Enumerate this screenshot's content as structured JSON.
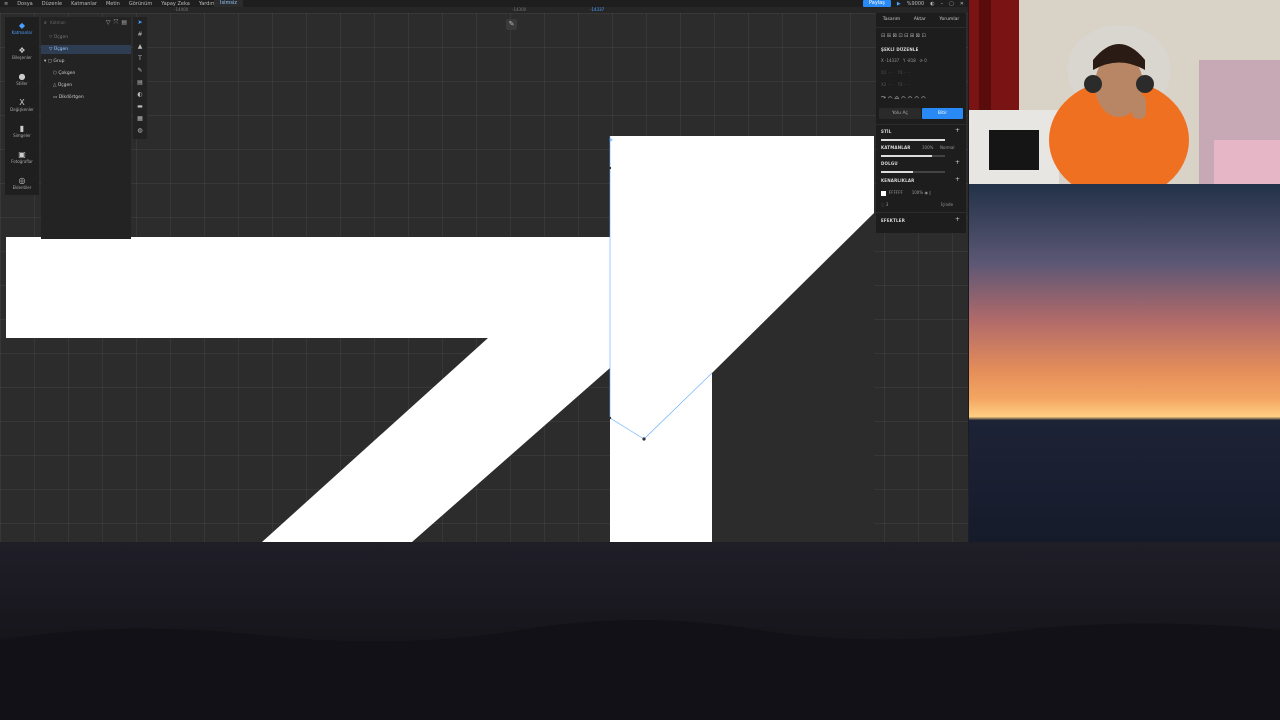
{
  "menubar": {
    "items": [
      "Dosya",
      "Düzenle",
      "Katmanlar",
      "Metin",
      "Görünüm",
      "Yapay Zeka",
      "Yardım"
    ],
    "active_tab": "İsimsiz",
    "share_label": "Paylaş",
    "zoom": "%9000"
  },
  "ruler": {
    "left_value": "-14400",
    "center_value": "-14300",
    "mark_value": "-14337"
  },
  "rail": {
    "items": [
      {
        "label": "Katmanlar",
        "icon": "layers-icon",
        "glyph": "◆",
        "active": true
      },
      {
        "label": "Bileşenler",
        "icon": "components-icon",
        "glyph": "❖",
        "active": false
      },
      {
        "label": "Stiller",
        "icon": "styles-icon",
        "glyph": "●",
        "active": false
      },
      {
        "label": "Değişkenler",
        "icon": "variables-icon",
        "glyph": "X",
        "active": false
      },
      {
        "label": "Simgeler",
        "icon": "icons-icon",
        "glyph": "▮",
        "active": false
      },
      {
        "label": "Fotoğraflar",
        "icon": "photos-icon",
        "glyph": "▣",
        "active": false
      },
      {
        "label": "Eklentiler",
        "icon": "plugins-icon",
        "glyph": "◎",
        "active": false
      }
    ]
  },
  "layers": {
    "search_placeholder": "Katman",
    "rows": [
      {
        "label": "Üçgen",
        "indent": 1,
        "state": "dim",
        "icon": "▽"
      },
      {
        "label": "Üçgen",
        "indent": 1,
        "state": "sel",
        "icon": "▽"
      },
      {
        "label": "Grup",
        "indent": 0,
        "state": "normal",
        "icon": "▢"
      },
      {
        "label": "Çokgen",
        "indent": 2,
        "state": "normal",
        "icon": "⬡"
      },
      {
        "label": "Üçgen",
        "indent": 2,
        "state": "normal",
        "icon": "△"
      },
      {
        "label": "Dikdörtgen",
        "indent": 2,
        "state": "normal",
        "icon": "▭"
      }
    ]
  },
  "tools": [
    "➤",
    "#",
    "▲",
    "T",
    "✎",
    "▤",
    "◐",
    "▬",
    "▦",
    "◍"
  ],
  "props": {
    "tabs": [
      "Tasarım",
      "Aktar",
      "Yorumlar"
    ],
    "shape_title": "ŞEKLİ DÜZENLE",
    "x_value": "-14337",
    "y_value": "-818",
    "rotation": "0",
    "btn_ghost": "Yolu Aç",
    "btn_primary": "Bitir",
    "sections": {
      "stil": "STİL",
      "katmanlar": "KATMANLAR",
      "opacity": "100%",
      "blend": "Normal",
      "dolgu": "DOLGU",
      "kenarliklar": "KENARLIKLAR",
      "stroke_hex": "FFFFFF",
      "stroke_opacity": "100%",
      "stroke_width": "3",
      "stroke_position": "İçinde",
      "efektler": "EFEKTLER"
    }
  },
  "colors": {
    "accent": "#2a8af5",
    "canvas_bg": "#2c2c2c",
    "shape_fill": "#ffffff"
  }
}
